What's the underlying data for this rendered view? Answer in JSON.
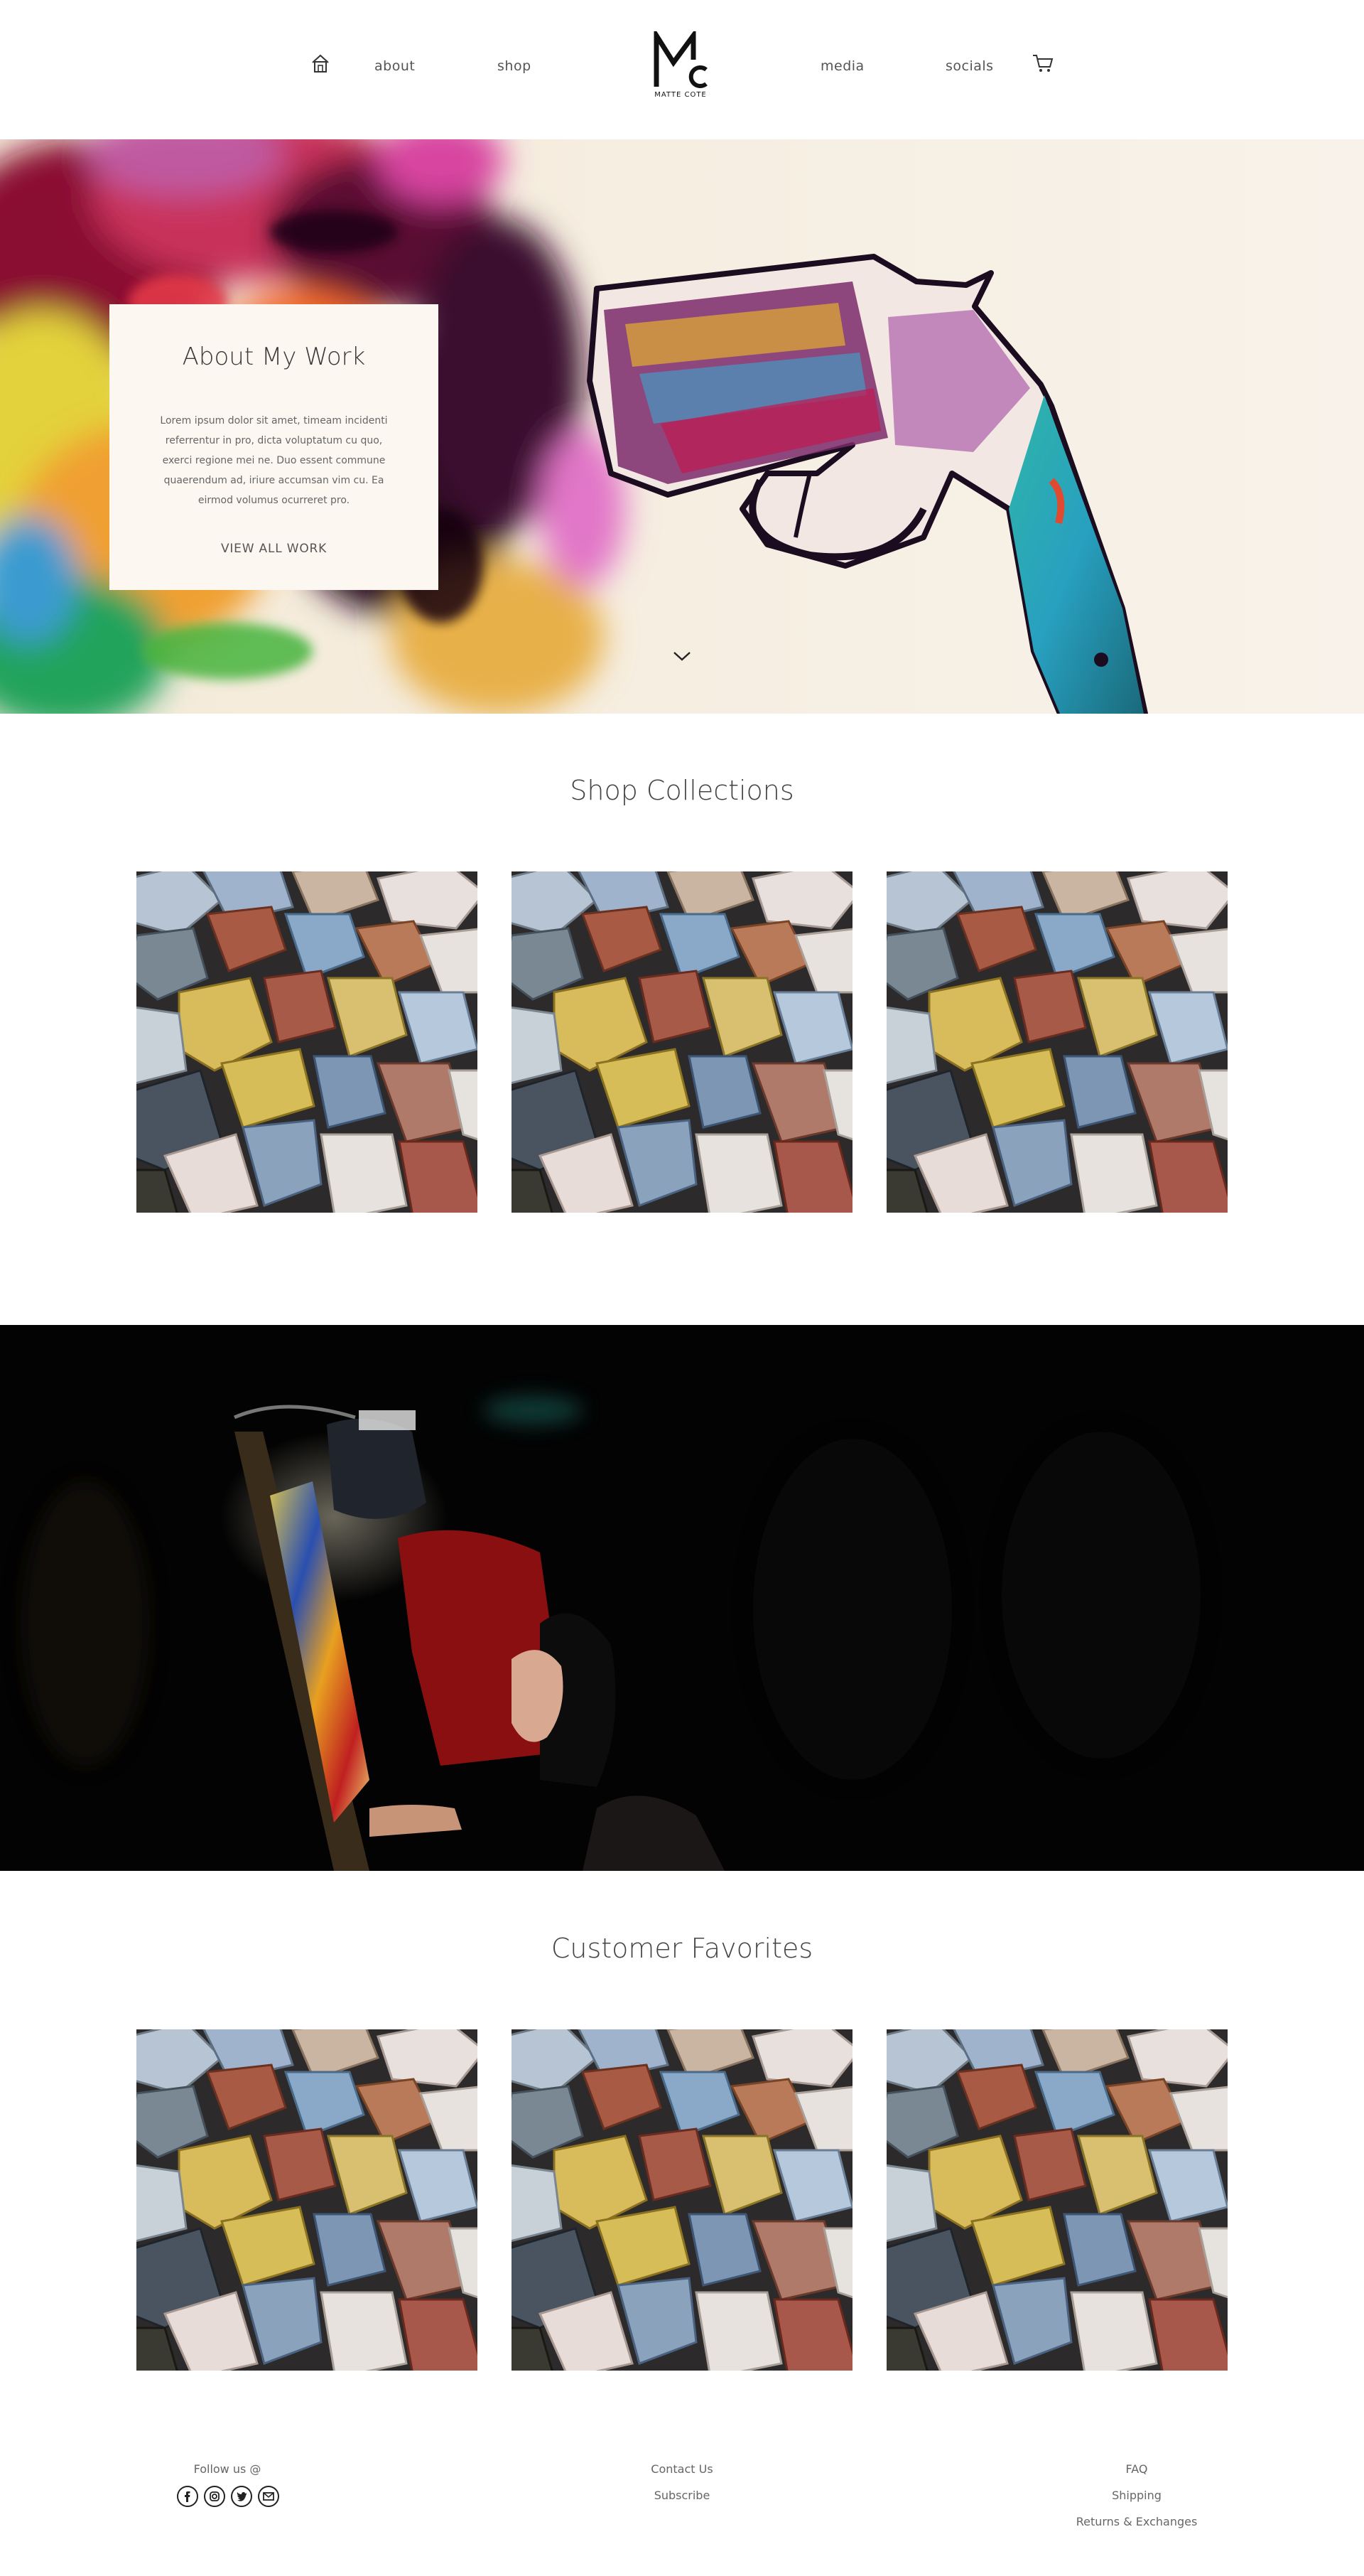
{
  "nav": {
    "about": "about",
    "shop": "shop",
    "media": "media",
    "socials": "socials",
    "logo_text": "MATTE COTE"
  },
  "hero": {
    "card_title": "About My Work",
    "card_body": "Lorem ipsum dolor sit amet, timeam incidenti referrentur in pro, dicta voluptatum cu quo, exerci regione mei ne. Duo essent commune quaerendum ad, iriure accumsan vim cu. Ea eirmod volumus ocurreret pro.",
    "card_link": "VIEW ALL WORK"
  },
  "sections": {
    "shop_title": "Shop Collections",
    "favorites_title": "Customer Favorites"
  },
  "footer": {
    "follow": "Follow us @",
    "contact": "Contact Us",
    "subscribe": "Subscribe",
    "faq": "FAQ",
    "shipping": "Shipping",
    "returns": "Returns & Exchanges"
  },
  "icons": [
    "home-icon",
    "cart-icon",
    "chevron-down-icon",
    "facebook-icon",
    "instagram-icon",
    "twitter-icon",
    "email-icon"
  ]
}
